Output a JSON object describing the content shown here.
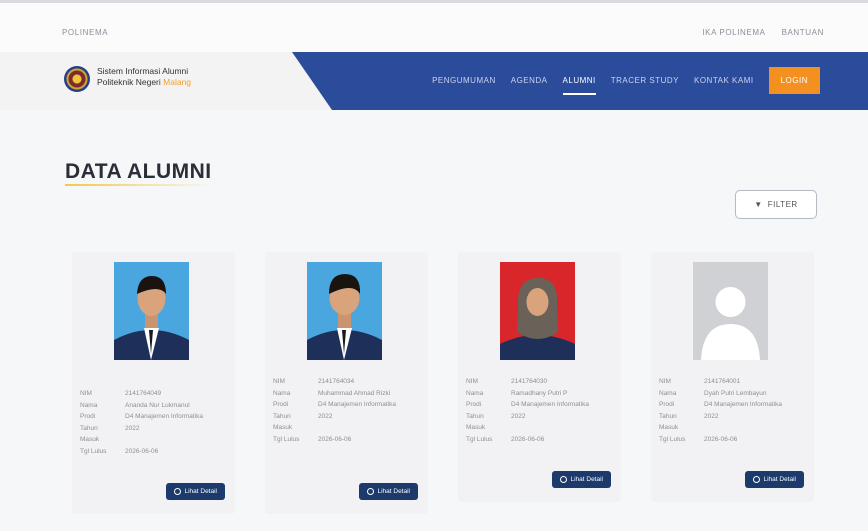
{
  "topbar": {
    "brand": "POLINEMA",
    "links": [
      "IKA POLINEMA",
      "BANTUAN"
    ]
  },
  "header": {
    "logo_line1": "Sistem Informasi Alumni",
    "logo_line2": "Politeknik Negeri",
    "logo_accent": "Malang",
    "nav": [
      {
        "label": "PENGUMUMAN",
        "active": false
      },
      {
        "label": "AGENDA",
        "active": false
      },
      {
        "label": "ALUMNI",
        "active": true
      },
      {
        "label": "TRACER STUDY",
        "active": false
      },
      {
        "label": "KONTAK KAMI",
        "active": false
      }
    ],
    "login_label": "LOGIN"
  },
  "page": {
    "title": "DATA ALUMNI",
    "filter_label": "FILTER"
  },
  "cards": [
    {
      "photo": "man-blue-bg",
      "rows": [
        {
          "k": "NIM",
          "v": "2141764049"
        },
        {
          "k": "Nama",
          "v": "Ananda Nur Lukmanul"
        },
        {
          "k": "Prodi",
          "v": "D4 Manajemen Informatika"
        },
        {
          "k": "Tahun",
          "v": "2022"
        },
        {
          "k": "Masuk",
          "v": ""
        },
        {
          "k": "Tgl Lulus",
          "v": "2026-06-06"
        }
      ],
      "button": "Lihat Detail"
    },
    {
      "photo": "man-blue-bg",
      "rows": [
        {
          "k": "NIM",
          "v": "2141764034"
        },
        {
          "k": "Nama",
          "v": "Muhammad Ahmad Rizki"
        },
        {
          "k": "Prodi",
          "v": "D4 Manajemen Informatika"
        },
        {
          "k": "Tahun",
          "v": "2022"
        },
        {
          "k": "Masuk",
          "v": ""
        },
        {
          "k": "Tgl Lulus",
          "v": "2026-06-06"
        }
      ],
      "button": "Lihat Detail"
    },
    {
      "photo": "woman-red-bg",
      "rows": [
        {
          "k": "NIM",
          "v": "2141764030"
        },
        {
          "k": "Nama",
          "v": "Ramadhany Putri P"
        },
        {
          "k": "Prodi",
          "v": "D4 Manajemen Informatika"
        },
        {
          "k": "Tahun",
          "v": "2022"
        },
        {
          "k": "Masuk",
          "v": ""
        },
        {
          "k": "Tgl Lulus",
          "v": "2026-06-06"
        }
      ],
      "button": "Lihat Detail"
    },
    {
      "photo": "placeholder",
      "rows": [
        {
          "k": "NIM",
          "v": "2141764001"
        },
        {
          "k": "Nama",
          "v": "Dyah Putri Lembayun"
        },
        {
          "k": "Prodi",
          "v": "D4 Manajemen Informatika"
        },
        {
          "k": "Tahun",
          "v": "2022"
        },
        {
          "k": "Masuk",
          "v": ""
        },
        {
          "k": "Tgl Lulus",
          "v": "2026-06-06"
        }
      ],
      "button": "Lihat Detail"
    }
  ]
}
